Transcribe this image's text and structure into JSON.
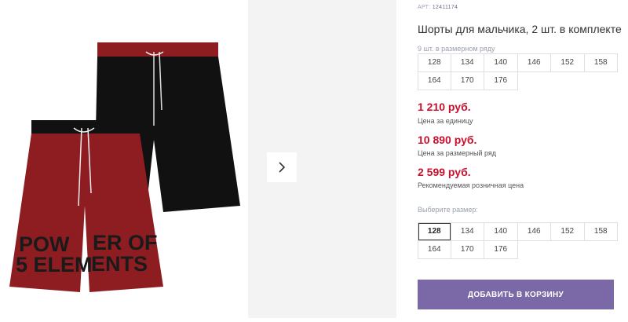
{
  "product": {
    "art_label": "АРТ:",
    "art_number": "12411174",
    "title": "Шорты для мальчика, 2 шт. в комплекте",
    "pack_note": "9 шт. в размерном ряду",
    "print_text_line1_left": "POW",
    "print_text_line1_right": "ER OF",
    "print_text_line2_left": "5 ELEM",
    "print_text_line2_right": "ENTS"
  },
  "sizes_row": [
    "128",
    "134",
    "140",
    "146",
    "152",
    "158",
    "164",
    "170",
    "176"
  ],
  "prices": [
    {
      "value": "1 210 руб.",
      "caption": "Цена за единицу"
    },
    {
      "value": "10 890 руб.",
      "caption": "Цена за размерный ряд"
    },
    {
      "value": "2 599 руб.",
      "caption": "Рекомендуемая розничная цена"
    }
  ],
  "size_select": {
    "label": "Выберите размер:",
    "options": [
      "128",
      "134",
      "140",
      "146",
      "152",
      "158",
      "164",
      "170",
      "176"
    ],
    "selected": "128"
  },
  "cta": {
    "add_to_cart": "ДОБАВИТЬ В КОРЗИНУ"
  },
  "icons": {
    "next": "chevron-right-icon"
  },
  "colors": {
    "accent_button": "#7b68a6",
    "price": "#c8102e",
    "shorts_red": "#8e1d22",
    "shorts_black": "#111111"
  }
}
